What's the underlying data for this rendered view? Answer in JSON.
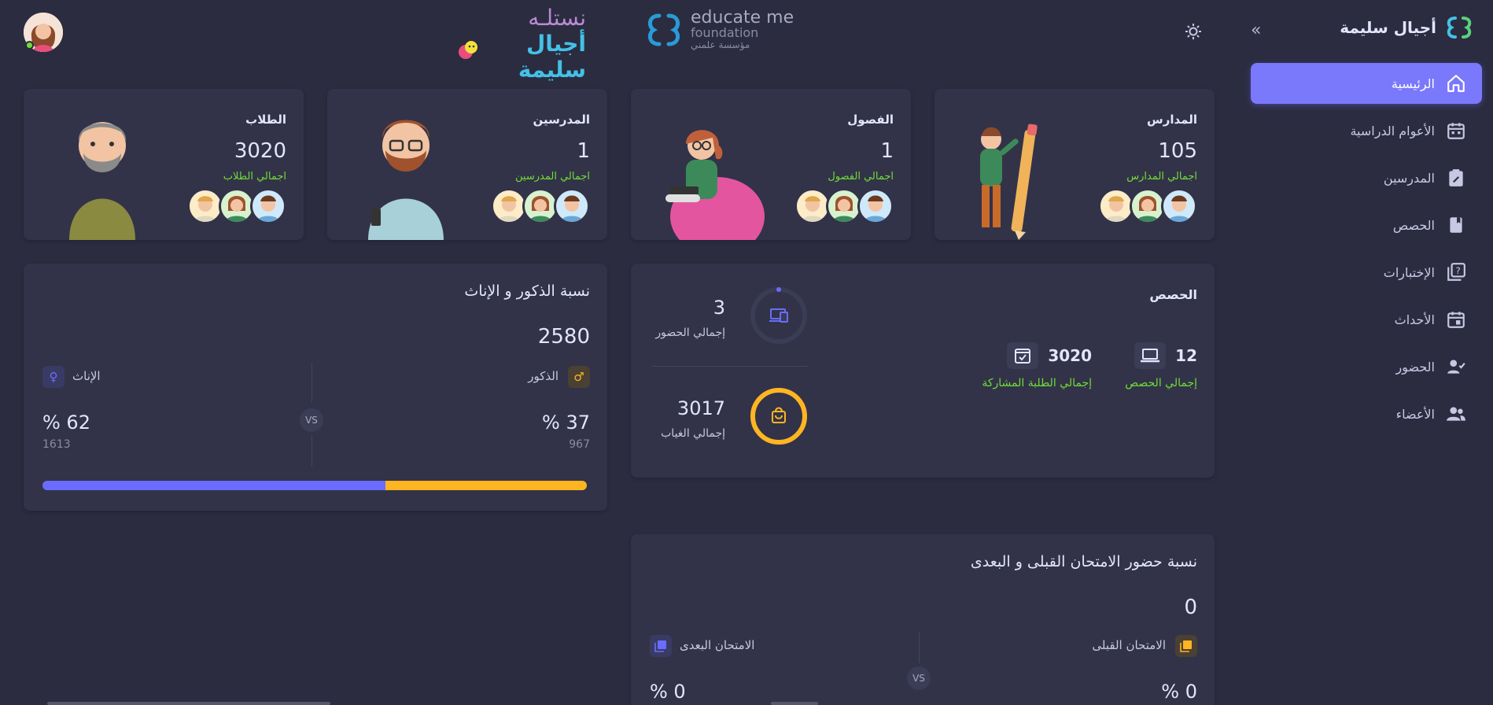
{
  "brand": {
    "name": "أجيال سليمة"
  },
  "sidebar": {
    "items": [
      {
        "label": "الرئيسية",
        "icon": "home-icon",
        "active": true
      },
      {
        "label": "الأعوام الدراسية",
        "icon": "calendar-icon"
      },
      {
        "label": "المدرسين",
        "icon": "clipboard-edit-icon"
      },
      {
        "label": "الحصص",
        "icon": "book-icon"
      },
      {
        "label": "الإختبارات",
        "icon": "quiz-icon"
      },
      {
        "label": "الأحداث",
        "icon": "event-icon"
      },
      {
        "label": "الحضور",
        "icon": "user-check-icon"
      },
      {
        "label": "الأعضاء",
        "icon": "people-icon"
      }
    ]
  },
  "header": {
    "educate": {
      "line1": "educate me",
      "line2": "foundation",
      "line3": "مؤسسة علمني"
    },
    "ajyal": {
      "line1": "نستلـه",
      "line2": "أجيال سليمة"
    }
  },
  "stats": [
    {
      "title": "المدارس",
      "value": "105",
      "sub": "اجمالي المدارس"
    },
    {
      "title": "الفصول",
      "value": "1",
      "sub": "اجمالي الفصول"
    },
    {
      "title": "المدرسين",
      "value": "1",
      "sub": "اجمالي المدرسين"
    },
    {
      "title": "الطلاب",
      "value": "3020",
      "sub": "اجمالي الطلاب"
    }
  ],
  "sessions": {
    "title": "الحصص",
    "total_sessions": {
      "value": "12",
      "label": "إجمالي الحصص"
    },
    "participants": {
      "value": "3020",
      "label": "إجمالي الطلبة المشاركة"
    },
    "attendance": {
      "value": "3",
      "label": "إجمالي الحضور"
    },
    "absence": {
      "value": "3017",
      "label": "إجمالي الغياب"
    }
  },
  "gender": {
    "title": "نسبة الذكور و الإناث",
    "total": "2580",
    "male": {
      "label": "الذكور",
      "percent": "% 37",
      "count": "967",
      "fraction": 0.37
    },
    "female": {
      "label": "الإناث",
      "percent": "% 62",
      "count": "1613",
      "fraction": 0.63
    },
    "vs": "VS",
    "colors": {
      "female": "#696cff",
      "male": "#ffb522"
    }
  },
  "exam": {
    "title": "نسبة حضور الامتحان القبلى و البعدى",
    "total": "0",
    "pre": {
      "label": "الامتحان القبلى",
      "percent": "% 0"
    },
    "post": {
      "label": "الامتحان البعدى",
      "percent": "% 0"
    },
    "vs": "VS"
  }
}
